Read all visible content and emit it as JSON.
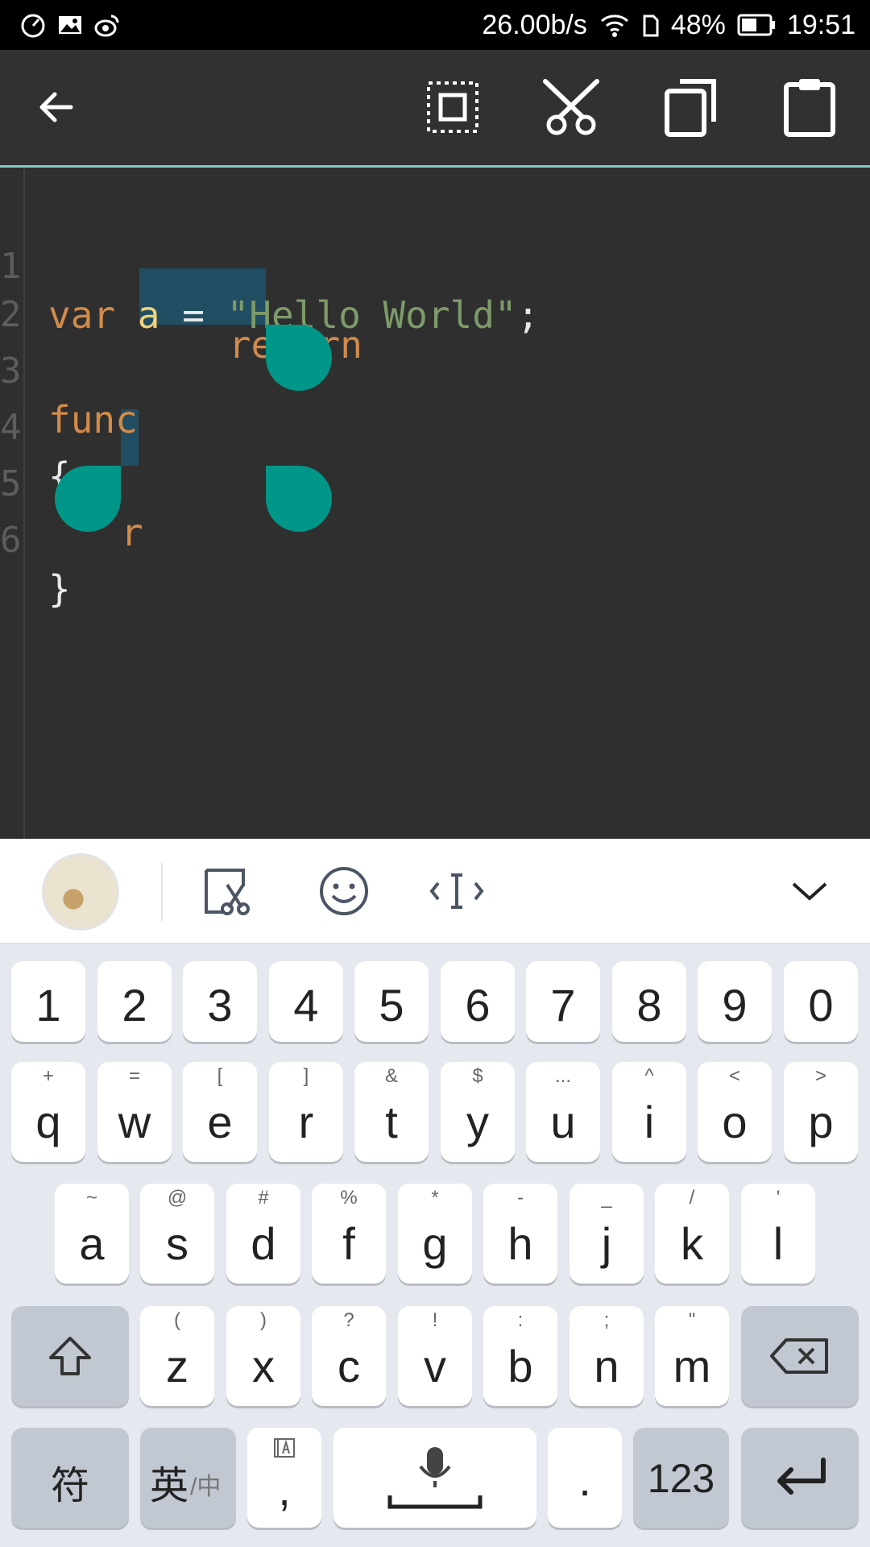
{
  "status_bar": {
    "network_speed": "26.00b/s",
    "battery": "48%",
    "time": "19:51",
    "icons": [
      "timer-icon",
      "image-icon",
      "weibo-icon",
      "wifi-icon",
      "sim-icon",
      "battery-icon"
    ]
  },
  "action_bar": {
    "icons": [
      "back-arrow-icon",
      "select-all-icon",
      "cut-icon",
      "copy-icon",
      "paste-icon"
    ],
    "accent_color": "#7ecdc0"
  },
  "editor": {
    "lines": [
      {
        "number": "1",
        "tokens": [
          {
            "t": "var",
            "c": "kw"
          },
          {
            "t": " ",
            "c": "op"
          },
          {
            "t": "a",
            "c": "var"
          },
          {
            "t": " = ",
            "c": "op"
          },
          {
            "t": "\"Hello World\"",
            "c": "str"
          },
          {
            "t": ";",
            "c": "op"
          }
        ]
      },
      {
        "number": "2",
        "tokens": []
      },
      {
        "number": "3",
        "tokens": [
          {
            "t": "func",
            "c": "kw"
          }
        ]
      },
      {
        "number": "4",
        "tokens": [
          {
            "t": "{",
            "c": "op"
          }
        ]
      },
      {
        "number": "5",
        "tokens": []
      },
      {
        "number": "6",
        "tokens": [
          {
            "t": "}",
            "c": "op"
          }
        ]
      }
    ],
    "autocomplete": "return",
    "partial_text": "r",
    "colors": {
      "keyword": "#d18b4a",
      "variable": "#f1d27b",
      "string": "#7d9b6a",
      "selection": "#214e63",
      "handle": "#009688"
    }
  },
  "keyboard_toolbar": {
    "icons": [
      "skin-avatar",
      "clipboard-cut-icon",
      "emoji-icon",
      "cursor-icon",
      "collapse-chevron-icon"
    ]
  },
  "keyboard": {
    "number_row": [
      "1",
      "2",
      "3",
      "4",
      "5",
      "6",
      "7",
      "8",
      "9",
      "0"
    ],
    "row1": [
      {
        "key": "q",
        "hint": "+"
      },
      {
        "key": "w",
        "hint": "="
      },
      {
        "key": "e",
        "hint": "["
      },
      {
        "key": "r",
        "hint": "]"
      },
      {
        "key": "t",
        "hint": "&"
      },
      {
        "key": "y",
        "hint": "$"
      },
      {
        "key": "u",
        "hint": "..."
      },
      {
        "key": "i",
        "hint": "^"
      },
      {
        "key": "o",
        "hint": "<"
      },
      {
        "key": "p",
        "hint": ">"
      }
    ],
    "row2": [
      {
        "key": "a",
        "hint": "~"
      },
      {
        "key": "s",
        "hint": "@"
      },
      {
        "key": "d",
        "hint": "#"
      },
      {
        "key": "f",
        "hint": "%"
      },
      {
        "key": "g",
        "hint": "*"
      },
      {
        "key": "h",
        "hint": "-"
      },
      {
        "key": "j",
        "hint": "_"
      },
      {
        "key": "k",
        "hint": "/"
      },
      {
        "key": "l",
        "hint": "'"
      }
    ],
    "row3": [
      {
        "key": "z",
        "hint": "("
      },
      {
        "key": "x",
        "hint": ")"
      },
      {
        "key": "c",
        "hint": "?"
      },
      {
        "key": "v",
        "hint": "!"
      },
      {
        "key": "b",
        "hint": ":"
      },
      {
        "key": "n",
        "hint": ";"
      },
      {
        "key": "m",
        "hint": "\""
      }
    ],
    "symbols_key": "符",
    "lang_key_main": "英",
    "lang_key_sub": "/中",
    "comma_key": ",",
    "period_key": ".",
    "numbers_key": "123"
  }
}
